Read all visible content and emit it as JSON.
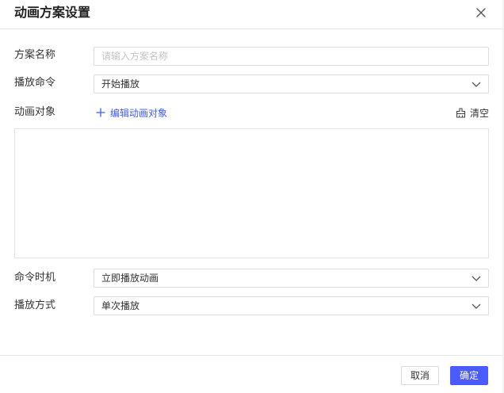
{
  "dialog": {
    "title": "动画方案设置",
    "close_icon": "close-icon"
  },
  "form": {
    "name_label": "方案名称",
    "name_placeholder": "请输入方案名称",
    "name_value": "",
    "command_label": "播放命令",
    "command_value": "开始播放",
    "objects_label": "动画对象",
    "edit_objects_label": "编辑动画对象",
    "clear_label": "清空",
    "timing_label": "命令时机",
    "timing_value": "立即播放动画",
    "mode_label": "播放方式",
    "mode_value": "单次播放"
  },
  "footer": {
    "cancel_label": "取消",
    "ok_label": "确定"
  },
  "colors": {
    "accent": "#4a5bff",
    "link": "#3d5afe"
  }
}
